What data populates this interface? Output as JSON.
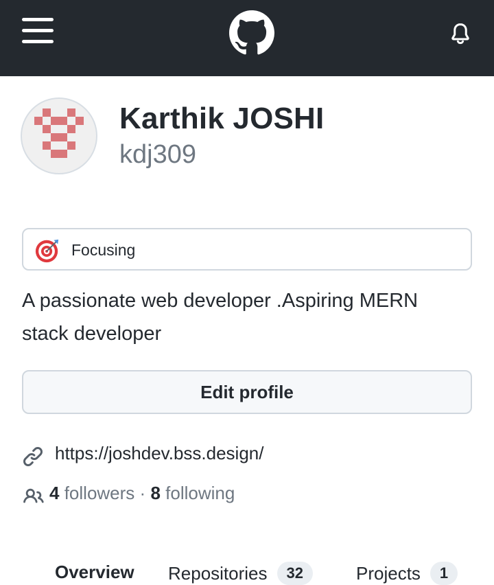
{
  "header": {
    "menu_icon": "hamburger-menu-icon",
    "logo_icon": "github-octocat-icon",
    "notifications_icon": "bell-icon",
    "background_color": "#24292f"
  },
  "profile": {
    "avatar_icon": "identicon-avatar",
    "avatar_color": "#d9777a",
    "full_name": "Karthik JOSHI",
    "username": "kdj309",
    "status": {
      "emoji_icon": "dart-target-emoji",
      "text": "Focusing"
    },
    "bio": "A passionate web developer .Aspiring MERN stack developer",
    "edit_button_label": "Edit profile",
    "website": {
      "icon": "link-icon",
      "url": "https://joshdev.bss.design/"
    },
    "followers": {
      "icon": "people-icon",
      "followers_count": "4",
      "followers_label": "followers",
      "separator": "·",
      "following_count": "8",
      "following_label": "following"
    }
  },
  "tabs": [
    {
      "label": "Overview",
      "counter": ""
    },
    {
      "label": "Repositories",
      "counter": "32"
    },
    {
      "label": "Projects",
      "counter": "1"
    }
  ]
}
